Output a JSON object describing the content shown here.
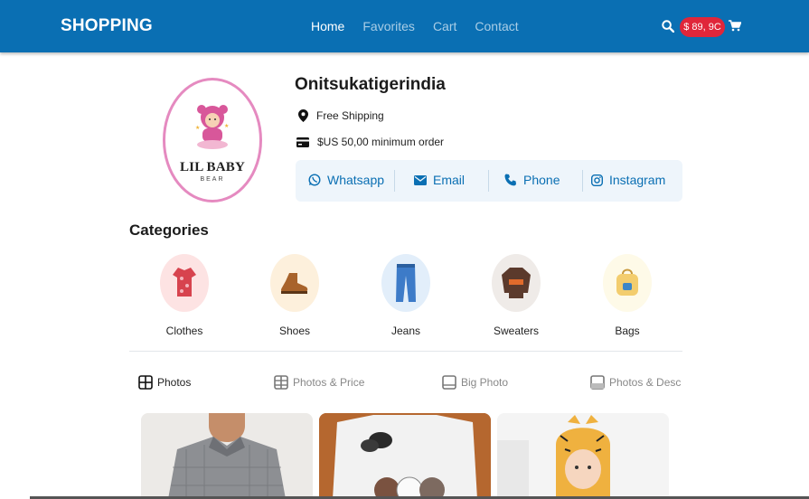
{
  "header": {
    "brand": "SHOPPING",
    "nav": [
      {
        "label": "Home",
        "active": true
      },
      {
        "label": "Favorites",
        "active": false
      },
      {
        "label": "Cart",
        "active": false
      },
      {
        "label": "Contact",
        "active": false
      }
    ],
    "cart_total": "$ 89, 9C",
    "bar_color": "#0a6fb3"
  },
  "store": {
    "logo_text": "LIL BABY",
    "logo_sub": "BEAR",
    "name": "Onitsukatigerindia",
    "shipping": "Free Shipping",
    "minimum_order": "$US 50,00 minimum order",
    "contacts": [
      {
        "label": "Whatsapp",
        "icon": "whatsapp-icon"
      },
      {
        "label": "Email",
        "icon": "email-icon"
      },
      {
        "label": "Phone",
        "icon": "phone-icon"
      },
      {
        "label": "Instagram",
        "icon": "instagram-icon"
      }
    ]
  },
  "categories": {
    "title": "Categories",
    "items": [
      {
        "label": "Clothes",
        "icon": "clothes-icon",
        "bg": "#fde3e3"
      },
      {
        "label": "Shoes",
        "icon": "shoe-icon",
        "bg": "#fdf0dc"
      },
      {
        "label": "Jeans",
        "icon": "jeans-icon",
        "bg": "#e2eefa"
      },
      {
        "label": "Sweaters",
        "icon": "sweater-icon",
        "bg": "#efebe8"
      },
      {
        "label": "Bags",
        "icon": "bag-icon",
        "bg": "#fefae8"
      }
    ]
  },
  "view_tabs": [
    {
      "label": "Photos",
      "active": true
    },
    {
      "label": "Photos & Price",
      "active": false
    },
    {
      "label": "Big Photo",
      "active": false
    },
    {
      "label": "Photos & Desc",
      "active": false
    }
  ]
}
